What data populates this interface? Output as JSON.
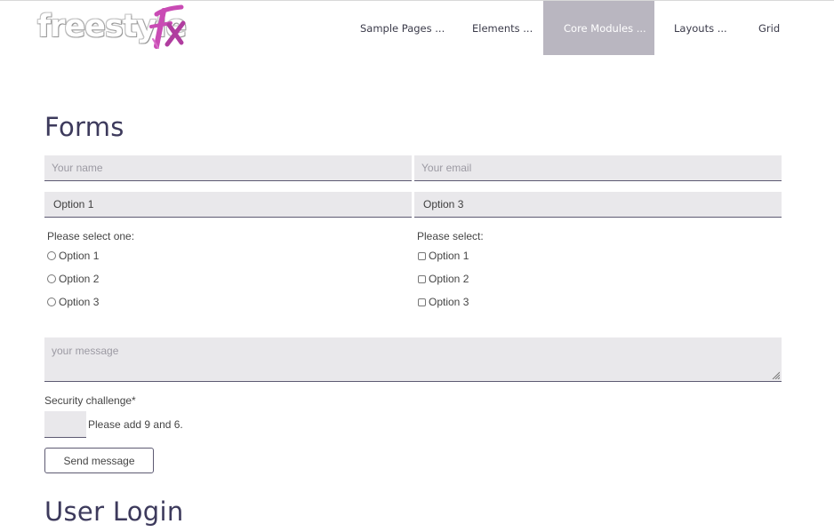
{
  "brand": {
    "logo_text": "freestyle",
    "logo_accent": "fx",
    "accent_color": "#c94bb4"
  },
  "nav": {
    "items": [
      {
        "label": "Sample Pages ...",
        "active": false
      },
      {
        "label": "Elements ...",
        "active": false
      },
      {
        "label": "Core Modules ...",
        "active": true
      },
      {
        "label": "Layouts ...",
        "active": false
      },
      {
        "label": "Grid",
        "active": false
      }
    ]
  },
  "forms": {
    "title": "Forms",
    "name_placeholder": "Your name",
    "email_placeholder": "Your email",
    "select_left_value": "Option 1",
    "select_right_value": "Option 3",
    "radio_group": {
      "label": "Please select one:",
      "options": [
        "Option 1",
        "Option 2",
        "Option 3"
      ]
    },
    "checkbox_group": {
      "label": "Please select:",
      "options": [
        "Option 1",
        "Option 2",
        "Option 3"
      ]
    },
    "message_placeholder": "your message",
    "security_label": "Security challenge*",
    "security_question": "Please add 9 and 6.",
    "send_label": "Send message"
  },
  "login": {
    "title": "User Login"
  }
}
